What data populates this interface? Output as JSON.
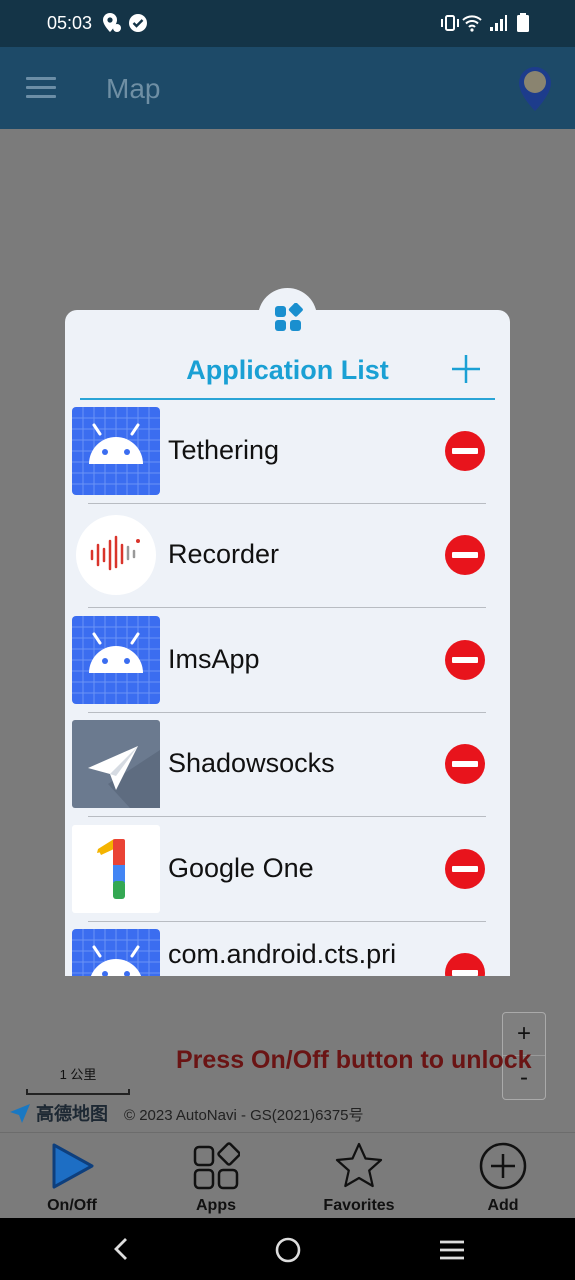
{
  "status_bar": {
    "time": "05:03"
  },
  "app_bar": {
    "title": "Map"
  },
  "dialog": {
    "title": "Application List",
    "apps": [
      {
        "name": "Tethering",
        "icon": "android-icon"
      },
      {
        "name": "Recorder",
        "icon": "recorder-icon"
      },
      {
        "name": "ImsApp",
        "icon": "android-icon"
      },
      {
        "name": "Shadowsocks",
        "icon": "paper-plane-icon"
      },
      {
        "name": "Google One",
        "icon": "google-one-icon"
      },
      {
        "name": "com.android.cts.pri",
        "icon": "android-icon"
      }
    ]
  },
  "map": {
    "unlock_message": "Press On/Off button to unlock",
    "zoom_in": "+",
    "zoom_out": "-",
    "scale_label": "1 公里",
    "logo_text": "高德地图",
    "copyright": "© 2023 AutoNavi - GS(2021)6375号"
  },
  "bottom_nav": {
    "items": [
      {
        "label": "On/Off"
      },
      {
        "label": "Apps"
      },
      {
        "label": "Favorites"
      },
      {
        "label": "Add"
      }
    ]
  },
  "colors": {
    "accent": "#1aa0d4",
    "remove": "#e8141c",
    "status_bar": "#143447",
    "app_bar": "#1d4a68"
  }
}
